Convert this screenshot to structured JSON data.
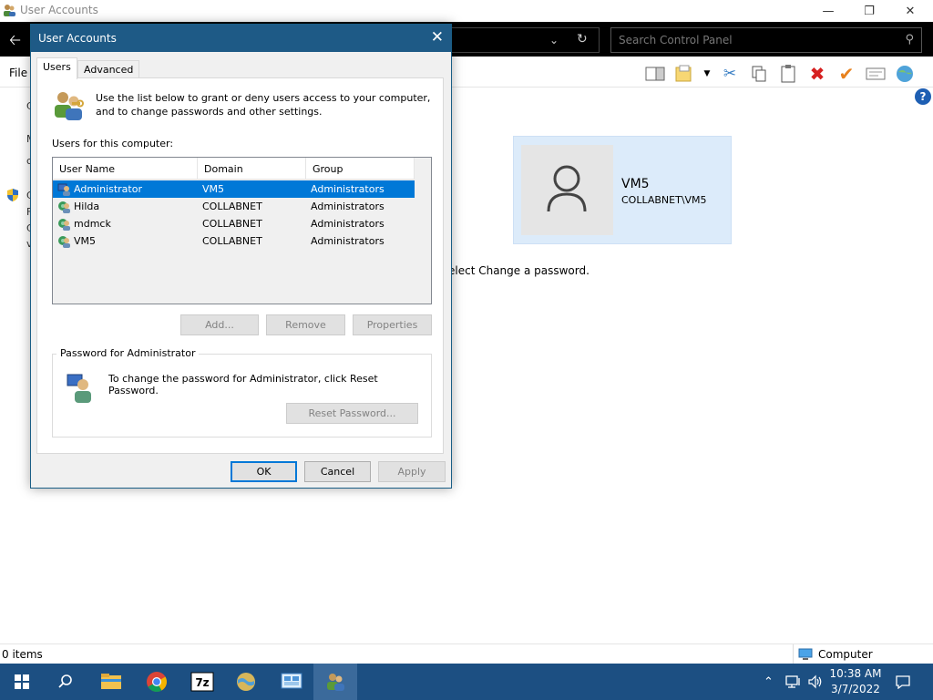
{
  "background_window": {
    "title": "User Accounts",
    "search_placeholder": "Search Control Panel",
    "menu_file": "File",
    "user_card": {
      "name": "VM5",
      "domain_user": "COLLABNET\\VM5"
    },
    "instruction_fragment": "elect Change a password.",
    "left_fragments": [
      "C",
      "M",
      "c",
      "C",
      "F",
      "C",
      "v"
    ],
    "status_items": "0 items",
    "status_location": "Computer"
  },
  "dialog": {
    "title": "User Accounts",
    "tabs": [
      {
        "label": "Users",
        "active": true
      },
      {
        "label": "Advanced",
        "active": false
      }
    ],
    "intro_text": "Use the list below to grant or deny users access to your computer, and to change passwords and other settings.",
    "users_label": "Users for this computer:",
    "columns": [
      "User Name",
      "Domain",
      "Group"
    ],
    "users": [
      {
        "name": "Administrator",
        "domain": "VM5",
        "group": "Administrators",
        "selected": true
      },
      {
        "name": "Hilda",
        "domain": "COLLABNET",
        "group": "Administrators",
        "selected": false
      },
      {
        "name": "mdmck",
        "domain": "COLLABNET",
        "group": "Administrators",
        "selected": false
      },
      {
        "name": "VM5",
        "domain": "COLLABNET",
        "group": "Administrators",
        "selected": false
      }
    ],
    "buttons": {
      "add": "Add...",
      "remove": "Remove",
      "properties": "Properties"
    },
    "password_group_title": "Password for Administrator",
    "password_text": "To change the password for Administrator, click Reset Password.",
    "reset_password": "Reset Password...",
    "ok": "OK",
    "cancel": "Cancel",
    "apply": "Apply"
  },
  "taskbar": {
    "time": "10:38 AM",
    "date": "3/7/2022",
    "apps": [
      "windows-start",
      "search",
      "file-explorer",
      "chrome",
      "7zip",
      "control-panel-globe",
      "remote-desktop",
      "user-accounts"
    ]
  },
  "colors": {
    "dialog_title_bg": "#1e5a86",
    "selection": "#0078d7",
    "taskbar": "#1c4f82",
    "user_card_bg": "#dcebfa"
  }
}
